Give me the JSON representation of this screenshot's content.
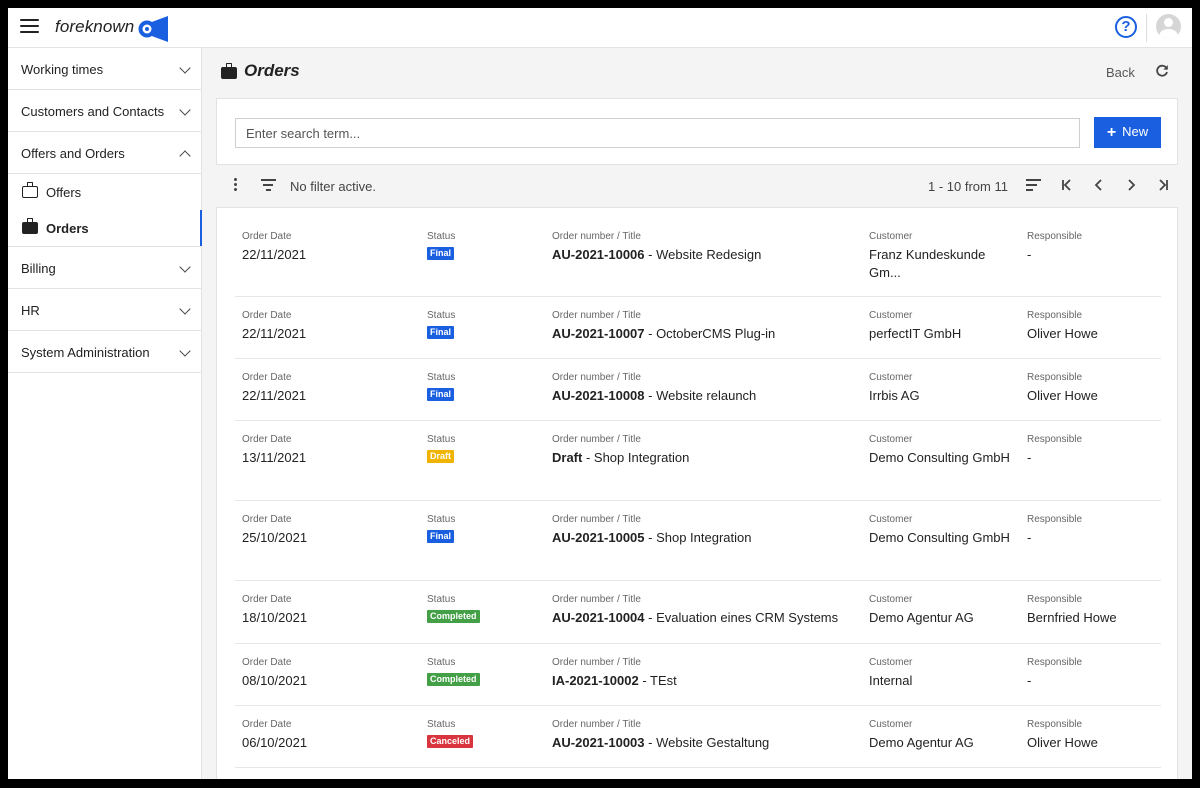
{
  "app": {
    "brand": "foreknown",
    "help_label": "?"
  },
  "sidebar": {
    "sections": [
      {
        "label": "Working times"
      },
      {
        "label": "Customers and Contacts"
      },
      {
        "label": "Offers and Orders"
      },
      {
        "label": "Billing"
      },
      {
        "label": "HR"
      },
      {
        "label": "System Administration"
      }
    ],
    "subitems": [
      {
        "label": "Offers"
      },
      {
        "label": "Orders"
      }
    ]
  },
  "page": {
    "title": "Orders",
    "back_label": "Back"
  },
  "search": {
    "placeholder": "Enter search term...",
    "new_label": "New"
  },
  "toolbar": {
    "filter_text": "No filter active.",
    "pager_text": "1 - 10 from 11"
  },
  "columns": {
    "date": "Order Date",
    "status": "Status",
    "order": "Order number / Title",
    "customer": "Customer",
    "responsible": "Responsible"
  },
  "colors": {
    "accent": "#1a5fe0",
    "final": "#1a5fe0",
    "draft": "#f0b400",
    "completed": "#43a047",
    "canceled": "#d9353f"
  },
  "orders": [
    {
      "date": "22/11/2021",
      "status": "Final",
      "number": "AU-2021-10006",
      "title": " - Website Redesign",
      "customer": "Franz Kundeskunde Gm...",
      "responsible": "-"
    },
    {
      "date": "22/11/2021",
      "status": "Final",
      "number": "AU-2021-10007",
      "title": " - OctoberCMS Plug-in",
      "customer": "perfectIT GmbH",
      "responsible": "Oliver Howe"
    },
    {
      "date": "22/11/2021",
      "status": "Final",
      "number": "AU-2021-10008",
      "title": " - Website relaunch",
      "customer": "Irrbis AG",
      "responsible": "Oliver Howe"
    },
    {
      "date": "13/11/2021",
      "status": "Draft",
      "number": "Draft",
      "title": " - Shop Integration",
      "customer": "Demo Consulting GmbH",
      "responsible": "-"
    },
    {
      "date": "25/10/2021",
      "status": "Final",
      "number": "AU-2021-10005",
      "title": " - Shop Integration",
      "customer": "Demo Consulting GmbH",
      "responsible": "-"
    },
    {
      "date": "18/10/2021",
      "status": "Completed",
      "number": "AU-2021-10004",
      "title": " - Evaluation eines CRM Systems",
      "customer": "Demo Agentur AG",
      "responsible": "Bernfried Howe"
    },
    {
      "date": "08/10/2021",
      "status": "Completed",
      "number": "IA-2021-10002",
      "title": " - TEst",
      "customer": "Internal",
      "responsible": "-"
    },
    {
      "date": "06/10/2021",
      "status": "Canceled",
      "number": "AU-2021-10003",
      "title": " - Website Gestaltung",
      "customer": "Demo Agentur AG",
      "responsible": "Oliver Howe"
    }
  ]
}
